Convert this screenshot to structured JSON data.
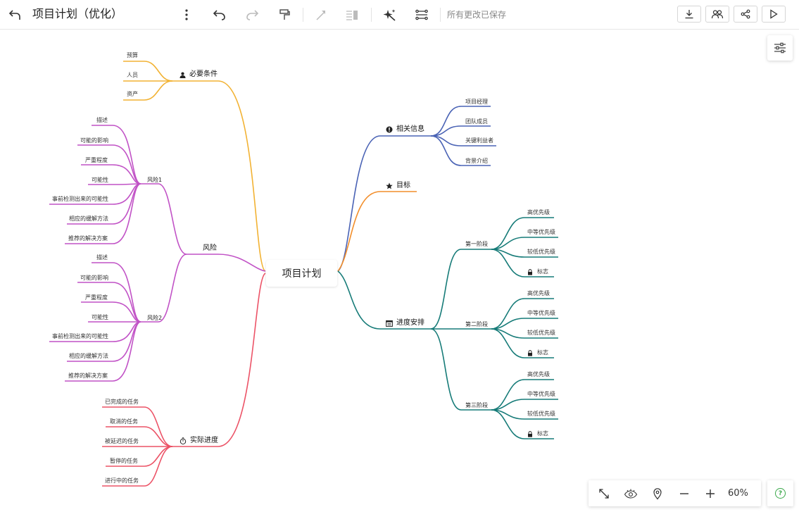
{
  "toolbar": {
    "title": "项目计划（优化）",
    "saved_status": "所有更改已保存",
    "icons": [
      "back-arrow-icon",
      "more-icon",
      "undo-icon",
      "redo-icon",
      "format-painter-icon",
      "connector-icon",
      "outline-icon",
      "magic-icon",
      "structure-icon",
      "download-icon",
      "collaborators-icon",
      "share-icon",
      "present-icon"
    ]
  },
  "map": {
    "central": "项目计划",
    "colors": {
      "yellow": "#F2B233",
      "purple": "#C152C6",
      "red": "#EC5367",
      "blue": "#4A63B5",
      "orange": "#F28E2B",
      "teal": "#167B78"
    },
    "prerequisites": {
      "label": "必要条件",
      "icon": "person-icon",
      "items": [
        "预算",
        "人员",
        "资产"
      ]
    },
    "risk": {
      "label": "风险",
      "risk1": {
        "label": "风险1",
        "items": [
          "描述",
          "可能的影响",
          "严重程度",
          "可能性",
          "事前检测出来的可能性",
          "相应的缓解方法",
          "推荐的解决方案"
        ]
      },
      "risk2": {
        "label": "风险2",
        "items": [
          "描述",
          "可能的影响",
          "严重程度",
          "可能性",
          "事前检测出来的可能性",
          "相应的缓解方法",
          "推荐的解决方案"
        ]
      }
    },
    "progress": {
      "label": "实际进度",
      "icon": "stopwatch-icon",
      "items": [
        "已完成的任务",
        "取消的任务",
        "被延迟的任务",
        "暂停的任务",
        "进行中的任务"
      ]
    },
    "info": {
      "label": "相关信息",
      "icon": "info-icon",
      "items": [
        "项目经理",
        "团队成员",
        "关键利益者",
        "背景介绍"
      ]
    },
    "goal": {
      "label": "目标",
      "icon": "star-icon"
    },
    "schedule": {
      "label": "进度安排",
      "icon": "calendar-icon",
      "phase1": {
        "label": "第一阶段",
        "items": [
          "高优先级",
          "中等优先级",
          "较低优先级",
          "标志"
        ]
      },
      "phase2": {
        "label": "第二阶段",
        "items": [
          "高优先级",
          "中等优先级",
          "较低优先级",
          "标志"
        ]
      },
      "phase3": {
        "label": "第三阶段",
        "items": [
          "高优先级",
          "中等优先级",
          "较低优先级",
          "标志"
        ]
      }
    }
  },
  "bottom": {
    "zoom": "60%",
    "icons": [
      "fit-screen-icon",
      "view-icon",
      "locate-icon",
      "zoom-out-icon",
      "zoom-in-icon",
      "help-icon"
    ]
  }
}
